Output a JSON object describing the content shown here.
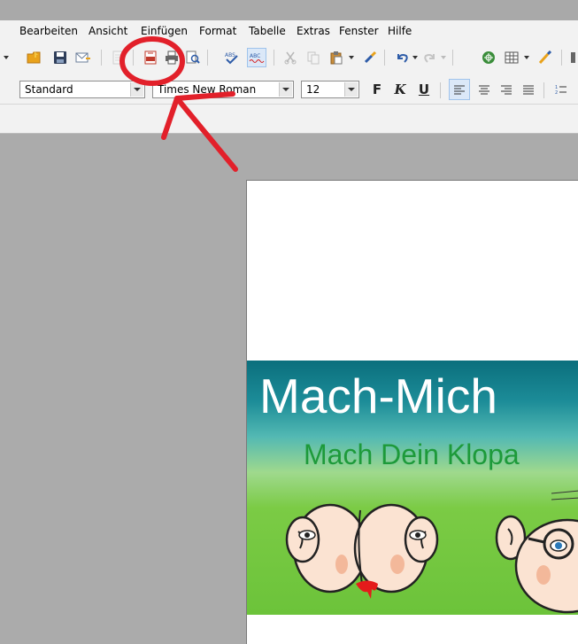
{
  "menubar": {
    "items": [
      {
        "label": "Bearbeiten"
      },
      {
        "label": "Ansicht"
      },
      {
        "label": "Einfügen"
      },
      {
        "label": "Format"
      },
      {
        "label": "Tabelle"
      },
      {
        "label": "Extras"
      },
      {
        "label": "Fenster"
      },
      {
        "label": "Hilfe"
      }
    ]
  },
  "toolbar": {
    "paragraph_style": "Standard",
    "font_name": "Times New Roman",
    "font_size": "12",
    "bold_label": "F",
    "italic_label": "K",
    "underline_label": "U"
  },
  "document": {
    "banner_title": "Mach-Mich",
    "banner_subtitle": "Mach Dein Klopa"
  },
  "colors": {
    "annotation_red": "#e2202a",
    "banner_teal": "#0b6f7d",
    "banner_green": "#6cc33a",
    "subtitle_green": "#1d9a3a"
  }
}
